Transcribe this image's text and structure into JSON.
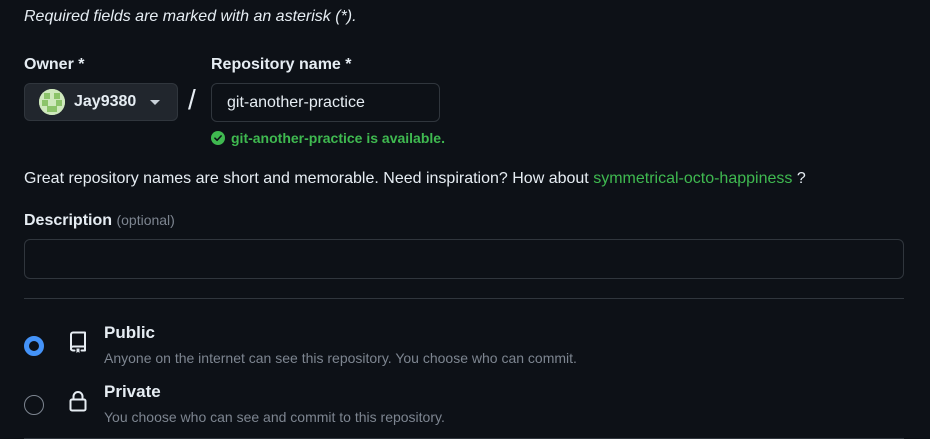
{
  "form": {
    "required_note": "Required fields are marked with an asterisk (*).",
    "owner_label": "Owner *",
    "owner_name": "Jay9380",
    "slash": "/",
    "repo_label": "Repository name *",
    "repo_value": "git-another-practice",
    "availability": "git-another-practice is available.",
    "suggestion_text": "Great repository names are short and memorable. Need inspiration? How about ",
    "suggestion_name": "symmetrical-octo-happiness",
    "suggestion_end": " ?",
    "description_label": "Description",
    "description_optional": "(optional)",
    "description_value": ""
  },
  "visibility": {
    "public": {
      "title": "Public",
      "desc": "Anyone on the internet can see this repository. You choose who can commit.",
      "icon": "repo-icon",
      "selected": true
    },
    "private": {
      "title": "Private",
      "desc": "You choose who can see and commit to this repository.",
      "icon": "lock-icon",
      "selected": false
    }
  },
  "colors": {
    "background": "#0d1117",
    "success": "#3fb950",
    "accent": "#4493f8",
    "muted": "#7d8590",
    "border": "#30363d"
  }
}
